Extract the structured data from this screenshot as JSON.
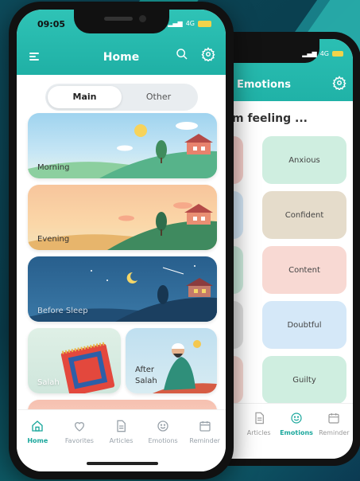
{
  "front": {
    "status_time": "09:05",
    "network": "4G",
    "title": "Home",
    "segments": [
      {
        "label": "Main",
        "active": true
      },
      {
        "label": "Other",
        "active": false
      }
    ],
    "cards": {
      "morning": "Morning",
      "evening": "Evening",
      "before_sleep": "Before Sleep",
      "salah": "Salah",
      "after_salah": "After Salah"
    },
    "tabs": [
      {
        "label": "Home",
        "icon": "home-icon",
        "active": true
      },
      {
        "label": "Favorites",
        "icon": "heart-icon",
        "active": false
      },
      {
        "label": "Articles",
        "icon": "article-icon",
        "active": false
      },
      {
        "label": "Emotions",
        "icon": "smile-icon",
        "active": false
      },
      {
        "label": "Reminder",
        "icon": "calendar-icon",
        "active": false
      }
    ],
    "accent": "#1aa79c"
  },
  "back": {
    "network": "4G",
    "title": "Emotions",
    "prompt": "m feeling ...",
    "emotions": [
      "Anxious",
      "Confident",
      "Content",
      "Doubtful",
      "Guilty"
    ],
    "emotion_colors": [
      "#cfeee0",
      "#e5dccb",
      "#f8d9d3",
      "#d5e8f8",
      "#cfeee0"
    ],
    "tabs": [
      {
        "label": "Articles",
        "icon": "article-icon",
        "active": false
      },
      {
        "label": "Emotions",
        "icon": "smile-icon",
        "active": true
      },
      {
        "label": "Reminder",
        "icon": "calendar-icon",
        "active": false
      }
    ]
  }
}
